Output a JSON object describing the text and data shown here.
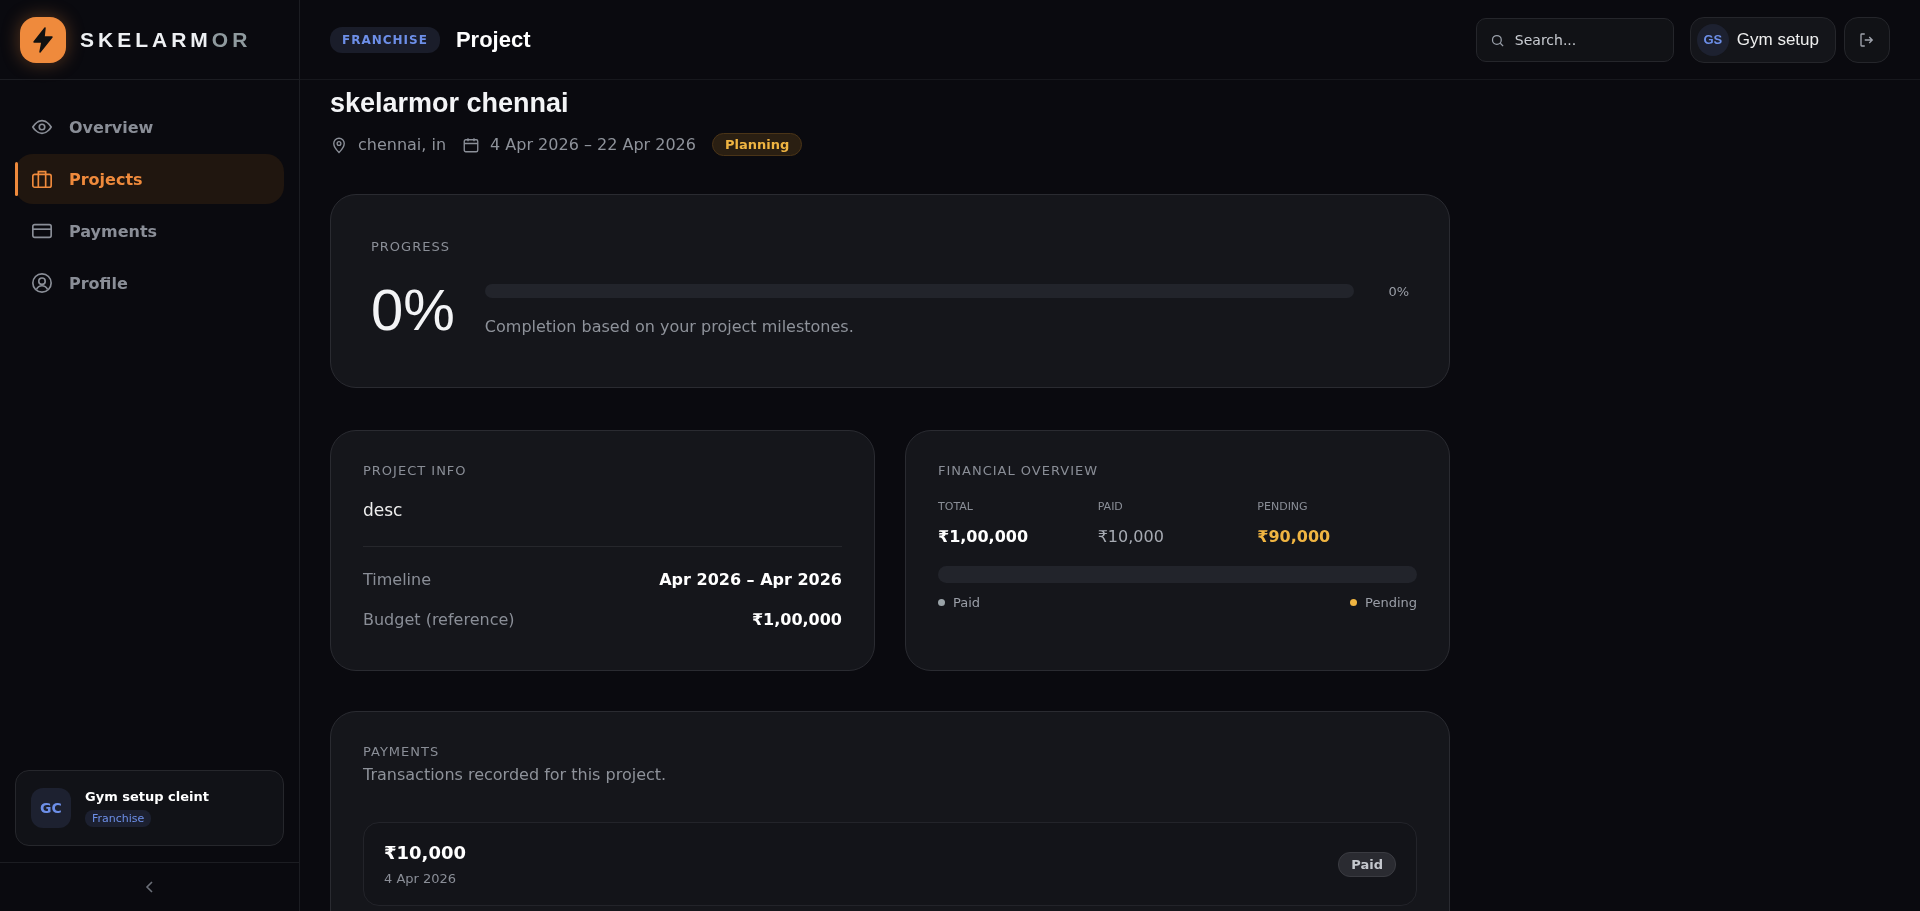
{
  "brand": {
    "name_main": "SKELARM",
    "name_fade": "OR"
  },
  "sidebar": {
    "items": [
      {
        "label": "Overview",
        "kind": "eye",
        "selected": false
      },
      {
        "label": "Projects",
        "kind": "briefcase",
        "selected": true
      },
      {
        "label": "Payments",
        "kind": "card",
        "selected": false
      },
      {
        "label": "Profile",
        "kind": "user",
        "selected": false
      }
    ],
    "user": {
      "initials": "GC",
      "name": "Gym setup cleint",
      "role": "Franchise"
    }
  },
  "header": {
    "badge": "FRANCHISE",
    "title": "Project",
    "search": {
      "placeholder": "Search..."
    },
    "user": {
      "initials": "GS",
      "name": "Gym setup"
    }
  },
  "project": {
    "title": "skelarmor chennai",
    "location": "chennai, in",
    "dates": "4 Apr 2026 – 22 Apr 2026",
    "status": "Planning"
  },
  "progress": {
    "heading": "PROGRESS",
    "big_value": "0%",
    "level": 0,
    "reading": "0%",
    "caption": "Completion based on your project milestones."
  },
  "project_info": {
    "heading": "PROJECT INFO",
    "description": "desc",
    "rows": [
      {
        "label": "Timeline",
        "value": "Apr 2026 – Apr 2026"
      },
      {
        "label": "Budget (reference)",
        "value": "₹1,00,000"
      }
    ]
  },
  "financial": {
    "heading": "FINANCIAL OVERVIEW",
    "stats": [
      {
        "label": "TOTAL",
        "value": "₹1,00,000",
        "kind": "total"
      },
      {
        "label": "PAID",
        "value": "₹10,000",
        "kind": "paid"
      },
      {
        "label": "PENDING",
        "value": "₹90,000",
        "kind": "pending"
      }
    ],
    "level": 0,
    "legend": [
      {
        "label": "Paid",
        "color": "#9aa3a8"
      },
      {
        "label": "Pending",
        "color": "#f0b542"
      }
    ]
  },
  "payments": {
    "heading": "PAYMENTS",
    "subtitle": "Transactions recorded for this project.",
    "items": [
      {
        "amount": "₹10,000",
        "date": "4 Apr 2026",
        "status": "Paid"
      }
    ]
  }
}
